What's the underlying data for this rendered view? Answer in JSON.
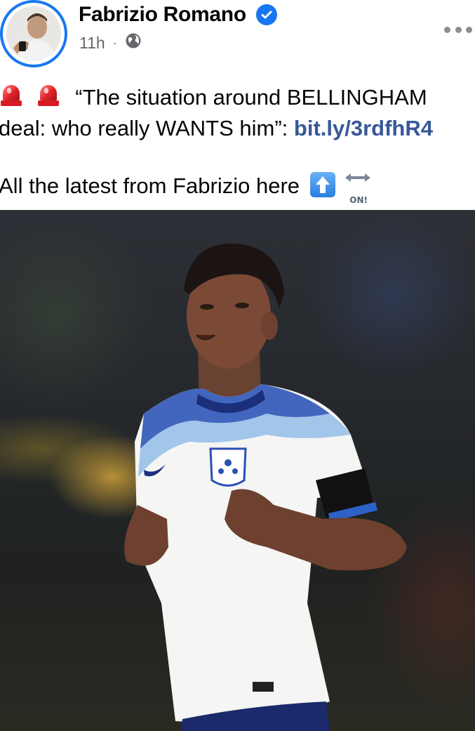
{
  "post": {
    "author": {
      "name": "Fabrizio Romano",
      "verified": true,
      "avatar_icon": "avatar-photo"
    },
    "meta": {
      "time": "11h",
      "separator": "·",
      "audience_icon": "globe-icon"
    },
    "more_icon": "more-options-icon",
    "caption": {
      "line1_text": "“The situation around BELLINGHAM",
      "line2_text": "deal: who really WANTS him",
      "line2_quote_colon": "”: ",
      "link_text": "bit.ly/3rdfhR4",
      "line3_text": "All the latest from Fabrizio here",
      "emoji_1": "rotating-light-icon",
      "emoji_2": "up-arrow-icon",
      "emoji_3": "left-right-arrow-icon",
      "on_badge": "ON!"
    },
    "photo": {
      "subject": "footballer-in-white-england-shirt"
    }
  },
  "colors": {
    "link": "#385898",
    "verified_badge": "#1877f2",
    "avatar_ring": "#1877f2",
    "meta_text": "#65676b",
    "name_text": "#050505"
  }
}
